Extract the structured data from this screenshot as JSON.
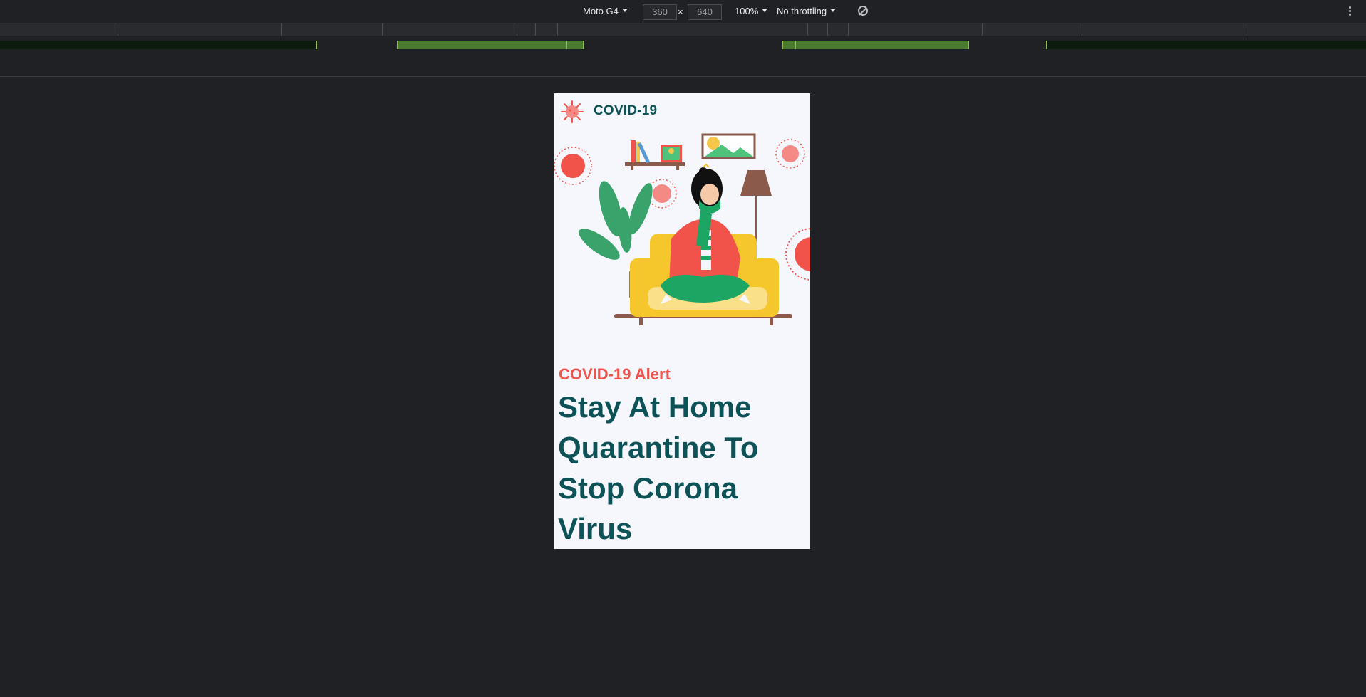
{
  "devtools": {
    "device_label": "Moto G4",
    "width_value": "360",
    "height_value": "640",
    "times": "×",
    "zoom_label": "100%",
    "throttling_label": "No throttling",
    "icons": [
      "caret-down-icon",
      "rotate-icon",
      "more-vert-icon"
    ]
  },
  "page": {
    "brand": "COVID-19",
    "alert_label": "COVID-19 Alert",
    "headline": "Stay At Home Quarantine To Stop Corona Virus",
    "colors": {
      "brand_teal": "#0d5257",
      "alert_red": "#f1524a",
      "page_bg": "#f6f7fd",
      "devtools_bg": "#202124"
    }
  }
}
